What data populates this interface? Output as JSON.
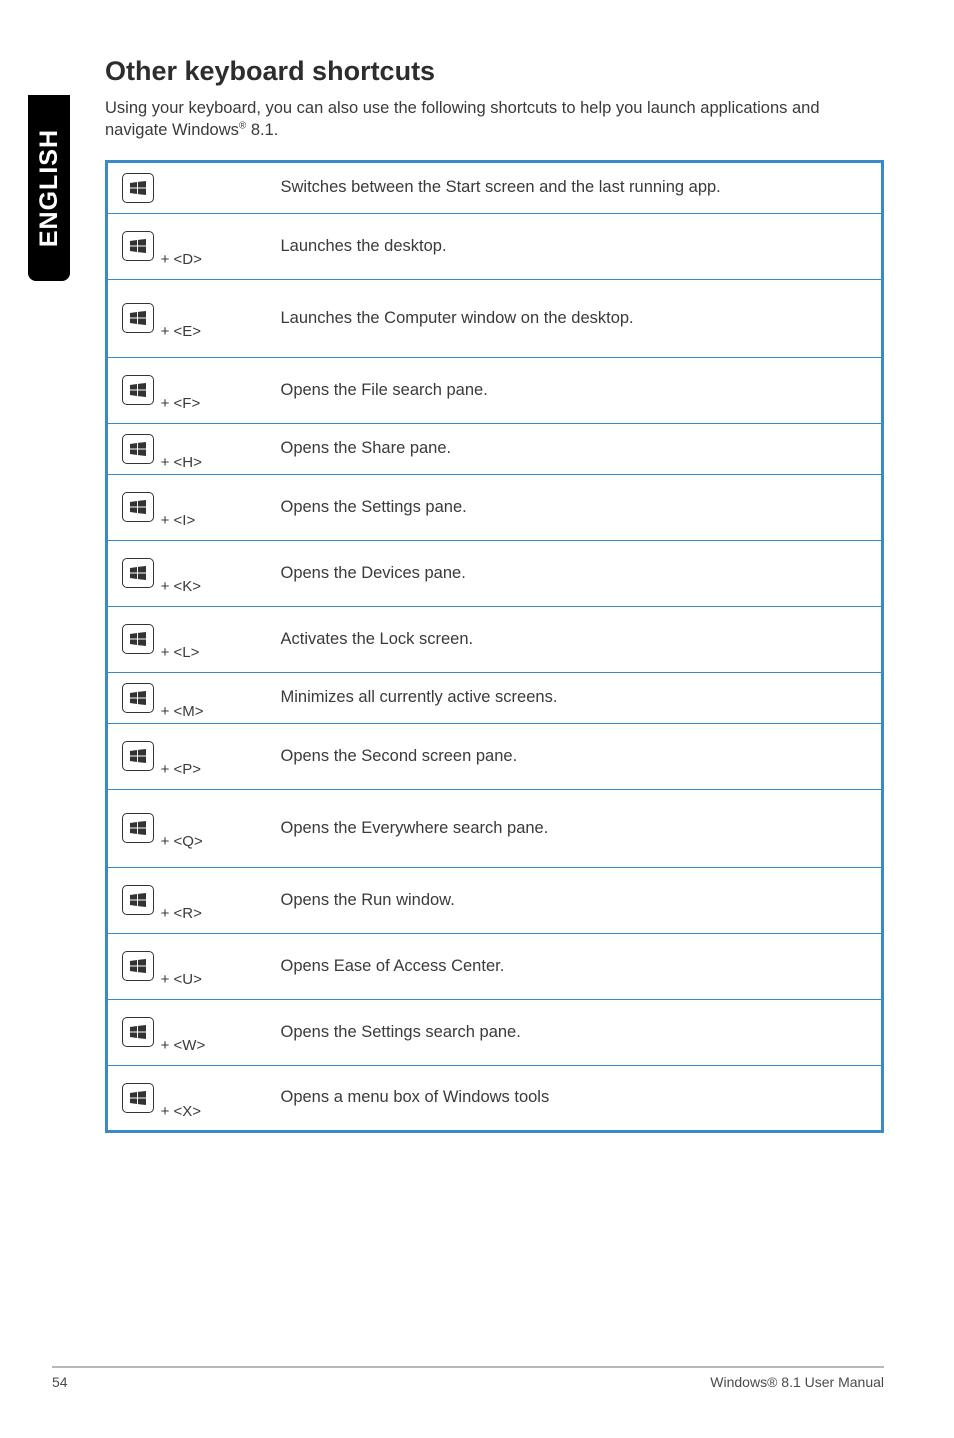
{
  "side_tab": "ENGLISH",
  "heading": "Other keyboard shortcuts",
  "intro_pre": "Using your keyboard, you can also use the following shortcuts to help you launch applications and navigate Windows",
  "intro_post": " 8.1.",
  "reg": "®",
  "shortcuts": [
    {
      "key": "",
      "desc": "Switches between the Start screen and the last running app."
    },
    {
      "key": "+ <D>",
      "desc": "Launches the desktop."
    },
    {
      "key": "+ <E>",
      "desc": "Launches the Computer window on the desktop."
    },
    {
      "key": "+ <F>",
      "desc": "Opens the File search pane."
    },
    {
      "key": "+ <H>",
      "desc": "Opens the Share pane."
    },
    {
      "key": "+ <I>",
      "desc": "Opens the Settings pane."
    },
    {
      "key": "+ <K>",
      "desc": "Opens the Devices pane."
    },
    {
      "key": "+ <L>",
      "desc": "Activates the Lock screen."
    },
    {
      "key": "+ <M>",
      "desc": "Minimizes all currently active screens."
    },
    {
      "key": "+ <P>",
      "desc": "Opens the Second screen pane."
    },
    {
      "key": "+ <Q>",
      "desc": "Opens the Everywhere search pane."
    },
    {
      "key": "+ <R>",
      "desc": "Opens the Run window."
    },
    {
      "key": "+ <U>",
      "desc": "Opens Ease of Access Center."
    },
    {
      "key": "+ <W>",
      "desc": "Opens the Settings search pane."
    },
    {
      "key": "+ <X>",
      "desc": "Opens a menu box of Windows tools"
    }
  ],
  "footer": {
    "page": "54",
    "title": "Windows® 8.1 User Manual"
  }
}
